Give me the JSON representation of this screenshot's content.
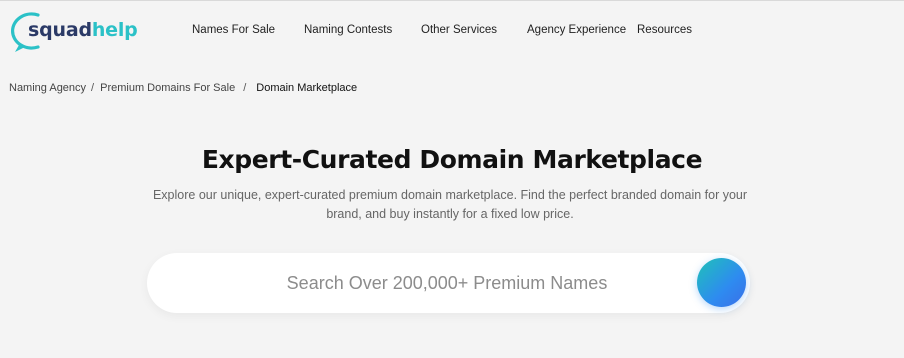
{
  "logo": {
    "part1": "squad",
    "part2": "help"
  },
  "nav": [
    {
      "label": "Names For Sale"
    },
    {
      "label": "Naming Contests"
    },
    {
      "label": "Other Services"
    },
    {
      "label": "Agency Experience"
    },
    {
      "label": "Resources"
    }
  ],
  "breadcrumb": [
    {
      "label": "Naming Agency"
    },
    {
      "label": "Premium Domains For Sale"
    },
    {
      "label": "Domain Marketplace"
    }
  ],
  "breadcrumb_separator": "/",
  "hero": {
    "title": "Expert-Curated Domain Marketplace",
    "subtitle_line1": "Explore our unique, expert-curated premium domain marketplace. Find the perfect branded domain for your",
    "subtitle_line2": "brand, and buy instantly for a fixed low price."
  },
  "search": {
    "placeholder": "Search Over 200,000+ Premium Names",
    "value": ""
  },
  "colors": {
    "brand_navy": "#2b3a67",
    "brand_teal": "#2bc1c7",
    "button_gradient_start": "#1fc2b8",
    "button_gradient_end": "#3a6fe8",
    "page_background": "#f4f4f4"
  }
}
